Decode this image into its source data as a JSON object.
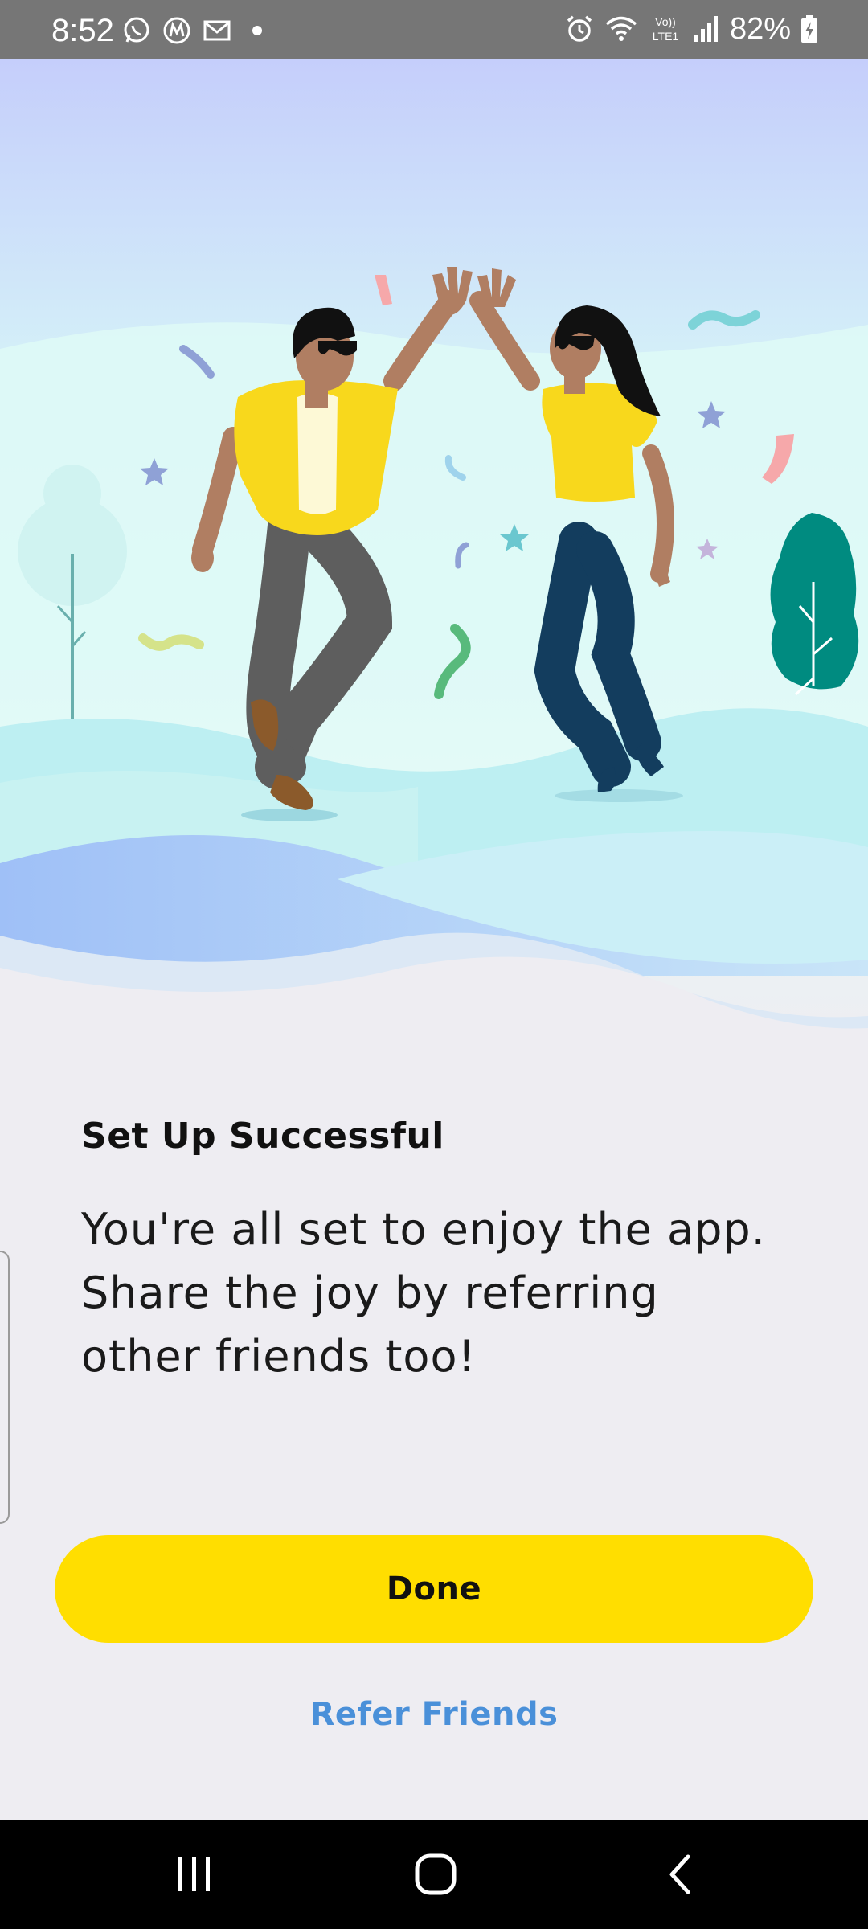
{
  "status_bar": {
    "time": "8:52",
    "battery_percent": "82%",
    "left_icons": [
      "whatsapp-icon",
      "motorola-icon",
      "mail-icon",
      "dot-icon"
    ],
    "right_icons": [
      "alarm-icon",
      "wifi-icon",
      "volte-icon",
      "signal-icon",
      "battery-charging-icon"
    ],
    "volte_label": "Vo)) LTE1"
  },
  "illustration": {
    "description_icon": "high-five-celebration-illustration",
    "colors": {
      "sky_top": "#C5CEFB",
      "sky_bottom": "#DFFBF8",
      "hill": "#BDEFF2",
      "shirt": "#F8D81C",
      "tree": "#008B80"
    }
  },
  "content": {
    "title": "Set Up Successful",
    "message_lines": [
      "You're all set to enjoy the app.",
      "Share the joy by referring",
      "other friends too!"
    ]
  },
  "actions": {
    "done_label": "Done",
    "refer_label": "Refer Friends"
  },
  "nav_bar": {
    "items": [
      "recent-apps-icon",
      "home-icon",
      "back-icon"
    ]
  },
  "colors": {
    "accent": "#FFDE00",
    "link": "#4A90D9",
    "background": "#EEEDF2"
  }
}
